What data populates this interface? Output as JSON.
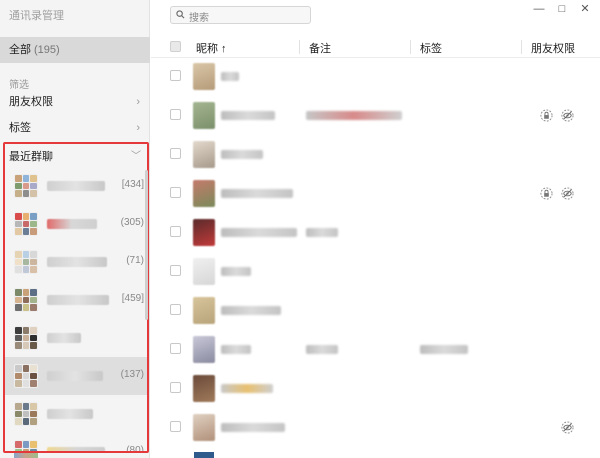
{
  "app": {
    "title": "通讯录管理"
  },
  "sidebar": {
    "all": {
      "label": "全部",
      "count": "(195)"
    },
    "filter_label": "筛选",
    "items": [
      {
        "label": "朋友权限",
        "chevron": "›"
      },
      {
        "label": "标签",
        "chevron": "›"
      }
    ],
    "recent_groups": {
      "label": "最近群聊",
      "chevron": "﹀",
      "groups": [
        {
          "count": "[434]"
        },
        {
          "count": "(305)"
        },
        {
          "count": "(71)"
        },
        {
          "count": "[459]"
        },
        {
          "count": ""
        },
        {
          "count": "(137)"
        },
        {
          "count": ""
        },
        {
          "count": "(80)"
        }
      ]
    }
  },
  "search": {
    "placeholder": "搜索",
    "icon": "search-icon"
  },
  "window_controls": {
    "minimize": "—",
    "maximize": "□",
    "close": "✕"
  },
  "table": {
    "headers": {
      "nickname": "昵称 ↑",
      "remark": "备注",
      "tag": "标签",
      "permission": "朋友权限"
    }
  },
  "colors": {
    "highlight_border": "#e5383b",
    "sidebar_bg": "#f4f4f4",
    "selected_bg": "#d9d9d9"
  }
}
